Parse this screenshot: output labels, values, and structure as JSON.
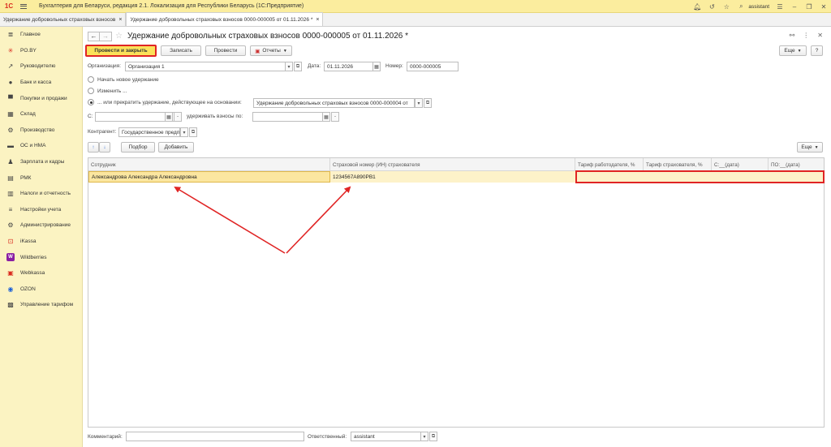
{
  "titlebar": {
    "logo": "1С",
    "app_title": "Бухгалтерия для Беларуси, редакция 2.1. Локализация для Республики Беларусь   (1С:Предприятие)",
    "user": "assistant"
  },
  "tabs": [
    {
      "label": "Удержание добровольных страховых взносов",
      "close": "×"
    },
    {
      "label": "Удержание добровольных страховых взносов 0000-000005 от 01.11.2026 *",
      "close": "×"
    }
  ],
  "sidebar": {
    "items": [
      {
        "label": "Главное",
        "icon": "list-icon"
      },
      {
        "label": "PO.BY",
        "icon": "snowflake-icon"
      },
      {
        "label": "Руководителю",
        "icon": "trend-icon"
      },
      {
        "label": "Банк и касса",
        "icon": "coin-icon"
      },
      {
        "label": "Покупки и продажи",
        "icon": "cart-icon"
      },
      {
        "label": "Склад",
        "icon": "warehouse-icon"
      },
      {
        "label": "Производство",
        "icon": "gear-icon"
      },
      {
        "label": "ОС и НМА",
        "icon": "car-icon"
      },
      {
        "label": "Зарплата и кадры",
        "icon": "person-icon"
      },
      {
        "label": "РМК",
        "icon": "register-icon"
      },
      {
        "label": "Налоги и отчетность",
        "icon": "chart-icon"
      },
      {
        "label": "Настройки учета",
        "icon": "settings-icon"
      },
      {
        "label": "Администрирование",
        "icon": "admin-gear-icon"
      },
      {
        "label": "iKassa",
        "icon": "ikassa-icon"
      },
      {
        "label": "Wildberries",
        "icon": "wildberries-icon"
      },
      {
        "label": "Webkassa",
        "icon": "webkassa-icon"
      },
      {
        "label": "OZON",
        "icon": "ozon-icon"
      },
      {
        "label": "Управление тарифом",
        "icon": "tariff-icon"
      }
    ]
  },
  "document": {
    "title": "Удержание добровольных страховых взносов 0000-000005 от 01.11.2026 *"
  },
  "toolbar": {
    "post_close": "Провести и закрыть",
    "save": "Записать",
    "post": "Провести",
    "reports": "Отчеты",
    "more": "Еще",
    "help": "?"
  },
  "form": {
    "org_label": "Организация:",
    "org_value": "Организация 1",
    "date_label": "Дата:",
    "date_value": "01.11.2026",
    "number_label": "Номер:",
    "number_value": "0000-000005",
    "radio_new": "Начать новое удержание",
    "radio_change": "Изменить ...",
    "radio_stop": "... или прекратить удержание, действующее на основании:",
    "basis_value": "Удержание добровольных страховых взносов 0000-000004 от",
    "from_label": "С:",
    "until_label": "удерживать взносы по:",
    "contractor_label": "Контрагент:",
    "contractor_value": "Государственное предпр"
  },
  "table_toolbar": {
    "select": "Подбор",
    "add": "Добавить",
    "more": "Еще"
  },
  "table": {
    "columns": [
      "Сотрудник",
      "Страховой номер (ИН) страхователя",
      "Тариф работодателя, %",
      "Тариф страхователя, %",
      "С:__(дата)",
      "ПО:__(дата)"
    ],
    "rows": [
      {
        "employee": "Александрова Александра Александровна",
        "insurance_number": "1234567A890PB1",
        "employer_rate": "",
        "insured_rate": "",
        "from": "",
        "to": ""
      }
    ]
  },
  "footer": {
    "comment_label": "Комментарий:",
    "comment_value": "",
    "responsible_label": "Ответственный:",
    "responsible_value": "assistant"
  },
  "colors": {
    "accent_yellow": "#fbe15a",
    "annotation_red": "#e02424",
    "sidebar_bg": "#fbf3c2"
  }
}
